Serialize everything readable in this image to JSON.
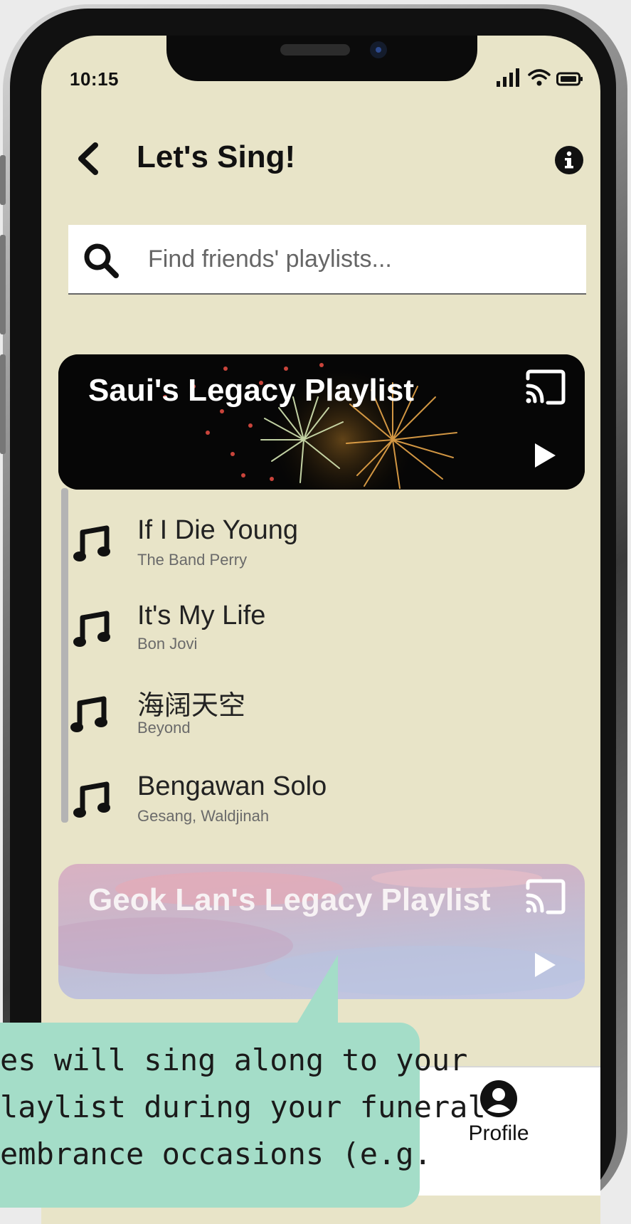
{
  "status_bar": {
    "time": "10:15",
    "icons": [
      "signal-icon",
      "wifi-icon",
      "battery-icon"
    ]
  },
  "header": {
    "title": "Let's Sing!",
    "back_icon": "chevron-left-icon",
    "info_icon": "info-icon"
  },
  "search": {
    "placeholder": "Find friends' playlists...",
    "icon": "search-icon"
  },
  "playlists": [
    {
      "title": "Saui's Legacy Playlist",
      "icons": [
        "cast-icon",
        "play-icon"
      ],
      "expanded": true,
      "songs": [
        {
          "title": "If I Die Young",
          "artist": "The Band Perry"
        },
        {
          "title": "It's My Life",
          "artist": "Bon Jovi"
        },
        {
          "title": "海阔天空",
          "artist": "Beyond"
        },
        {
          "title": "Bengawan Solo",
          "artist": "Gesang, Waldjinah"
        }
      ]
    },
    {
      "title": "Geok Lan's Legacy Playlist",
      "icons": [
        "cast-icon",
        "play-icon"
      ],
      "expanded": false
    }
  ],
  "tab_bar": {
    "profile_label": "Profile",
    "profile_icon": "profile-icon"
  },
  "tooltip": {
    "lines": [
      "es will sing along to your",
      "laylist during your funeral",
      "embrance occasions (e.g."
    ]
  },
  "colors": {
    "screen_background": "#e8e4c8",
    "tooltip_background": "#a4ddc8",
    "tab_bar_background": "#ffffff"
  }
}
